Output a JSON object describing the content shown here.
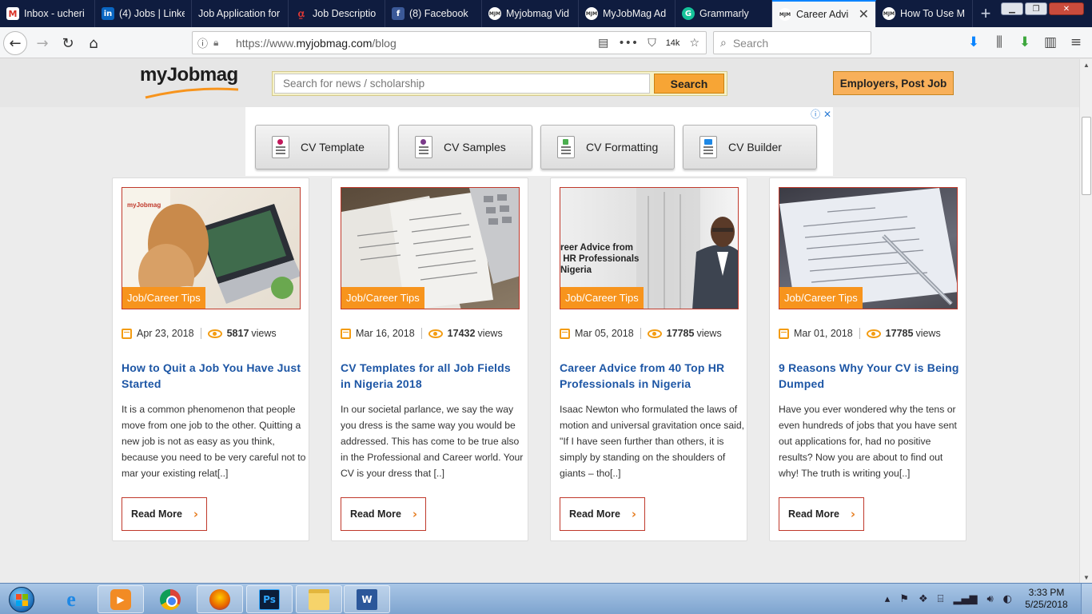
{
  "browser": {
    "tabs": [
      {
        "title": "Inbox - ucheri",
        "favicon": "gmail-icon"
      },
      {
        "title": "(4) Jobs | Linke",
        "favicon": "linkedin-icon"
      },
      {
        "title": "Job Application for",
        "favicon": ""
      },
      {
        "title": "Job Descriptio",
        "favicon": "jobdescription-icon"
      },
      {
        "title": "(8) Facebook",
        "favicon": "facebook-icon"
      },
      {
        "title": "Myjobmag Vid",
        "favicon": "myjobmag-icon"
      },
      {
        "title": "MyJobMag Ad",
        "favicon": "myjobmag-icon"
      },
      {
        "title": "Grammarly",
        "favicon": "grammarly-icon"
      },
      {
        "title": "Career Advi",
        "favicon": "myjobmag-icon",
        "active": true
      },
      {
        "title": "How To Use M",
        "favicon": "myjobmag-icon"
      }
    ],
    "url": {
      "scheme": "https://www.",
      "host": "myjobmag.com",
      "path": "/blog"
    },
    "pocket_count": "14k",
    "search_placeholder": "Search"
  },
  "site": {
    "logo_text": "myJobmag",
    "search_placeholder": "Search for news / scholarship",
    "search_button": "Search",
    "post_job_button": "Employers, Post Job",
    "ad_buttons": [
      {
        "label": "CV Template",
        "icon": "cv-template-icon"
      },
      {
        "label": "CV Samples",
        "icon": "cv-samples-icon"
      },
      {
        "label": "CV Formatting",
        "icon": "cv-formatting-icon"
      },
      {
        "label": "CV Builder",
        "icon": "cv-builder-icon"
      }
    ]
  },
  "cards": [
    {
      "tag": "Job/Career Tips",
      "date": "Apr 23, 2018",
      "views": "5817",
      "views_label": "views",
      "title": "How to Quit a Job You Have Just Started",
      "excerpt": "It is a common phenomenon that people move from one job to the other.  Quitting a new job is not as easy as you think, because you need to be very careful not to mar your existing relat[..]",
      "read_more": "Read More"
    },
    {
      "tag": "Job/Career Tips",
      "date": "Mar 16, 2018",
      "views": "17432",
      "views_label": "views",
      "title": "CV Templates for all Job Fields in Nigeria 2018",
      "excerpt": "In our societal parlance, we say the way you dress is the same way you would be addressed. This has come to be true also in the Professional and Career world. Your CV is your dress that [..]",
      "read_more": "Read More"
    },
    {
      "tag": "Job/Career Tips",
      "date": "Mar 05, 2018",
      "views": "17785",
      "views_label": "views",
      "title": "Career Advice from 40 Top HR Professionals in Nigeria",
      "excerpt": "Isaac Newton who formulated the laws of motion and universal gravitation once said, \"If I have seen further than others, it is simply by standing on the shoulders of giants – tho[..]",
      "read_more": "Read More",
      "image_text": "reer Advice from\n HR Professionals\nNigeria"
    },
    {
      "tag": "Job/Career Tips",
      "date": "Mar 01, 2018",
      "views": "17785",
      "views_label": "views",
      "title": "9 Reasons Why Your CV is Being Dumped",
      "excerpt": "Have you ever wondered why the tens or even hundreds of jobs that you have sent out applications for, had no positive results? Now you are about to find out why! The truth is writing you[..]",
      "read_more": "Read More"
    }
  ],
  "taskbar": {
    "apps": [
      "internet-explorer",
      "media-player",
      "chrome",
      "firefox",
      "photoshop",
      "file-explorer",
      "word"
    ],
    "time": "3:33 PM",
    "date": "5/25/2018"
  },
  "colors": {
    "accent_orange": "#f7941d",
    "title_blue": "#1d56a5",
    "tabstrip_bg": "#0f1c3f"
  }
}
